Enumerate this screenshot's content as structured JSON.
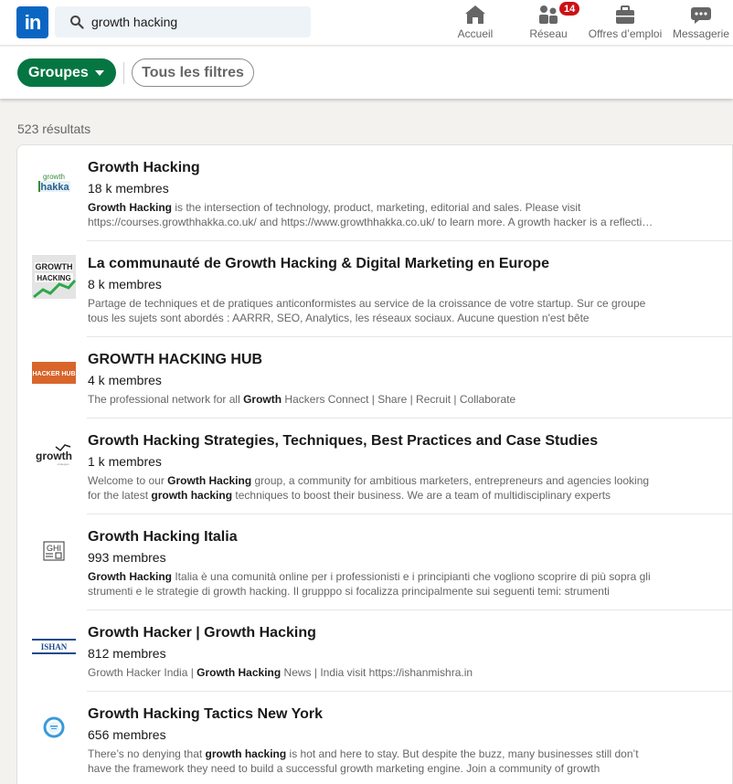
{
  "nav": {
    "logo_text": "in",
    "search_value": "growth hacking",
    "items": [
      {
        "label": "Accueil",
        "icon": "home-icon"
      },
      {
        "label": "Réseau",
        "icon": "network-icon",
        "badge": "14"
      },
      {
        "label": "Offres d’emploi",
        "icon": "briefcase-icon"
      },
      {
        "label": "Messagerie",
        "icon": "messaging-icon"
      }
    ]
  },
  "filters": {
    "active": "Groupes",
    "all": "Tous les filtres"
  },
  "results_count": "523 résultats",
  "colors": {
    "linkedin_blue": "#0a66c2",
    "active_filter_green": "#057642",
    "badge_red": "#cc1016"
  },
  "results": [
    {
      "title": "Growth Hacking",
      "members": "18 k membres",
      "desc_parts": [
        {
          "t": "Growth Hacking",
          "b": true
        },
        {
          "t": " is the intersection of technology, product, marketing, editorial and sales. Please visit https://courses.growthhakka.co.uk/ and https://www.growthhakka.co.uk/ to learn more. A growth hacker is a reflection of what is possible in",
          "b": false
        }
      ],
      "thumb_text": "growth hakka"
    },
    {
      "title": "La communauté de Growth Hacking & Digital Marketing en Europe",
      "members": "8 k membres",
      "desc_parts": [
        {
          "t": "Partage de techniques et de pratiques anticonformistes au service de la croissance de votre startup. Sur ce groupe tous les sujets sont abordés : AARRR, SEO, Analytics, les réseaux sociaux. Aucune question n'est bête",
          "b": false
        }
      ],
      "thumb_text": "GROWTH HACKING"
    },
    {
      "title": "GROWTH HACKING HUB",
      "members": "4 k membres",
      "desc_parts": [
        {
          "t": "The professional network for all ",
          "b": false
        },
        {
          "t": "Growth",
          "b": true
        },
        {
          "t": " Hackers Connect | Share | Recruit | Collaborate",
          "b": false
        }
      ],
      "thumb_text": "HACKER HUB"
    },
    {
      "title": "Growth Hacking Strategies, Techniques, Best Practices and Case Studies",
      "members": "1 k membres",
      "desc_parts": [
        {
          "t": "Welcome to our ",
          "b": false
        },
        {
          "t": "Growth Hacking",
          "b": true
        },
        {
          "t": " group, a community for ambitious marketers, entrepreneurs and agencies looking for the latest ",
          "b": false
        },
        {
          "t": "growth hacking",
          "b": true
        },
        {
          "t": " techniques to boost their business. We are a team of multidisciplinary experts",
          "b": false
        }
      ],
      "thumb_text": "growth"
    },
    {
      "title": "Growth Hacking Italia",
      "members": "993 membres",
      "desc_parts": [
        {
          "t": "Growth Hacking",
          "b": true
        },
        {
          "t": " Italia è una comunità online per i professionisti e i principianti che vogliono scoprire di più sopra gli strumenti e le strategie di growth hacking. Il grupppo si focalizza principalmente sui seguenti temi: strumenti",
          "b": false
        }
      ],
      "thumb_text": "GHI"
    },
    {
      "title": "Growth Hacker | Growth Hacking",
      "members": "812 membres",
      "desc_parts": [
        {
          "t": "Growth Hacker India | ",
          "b": false
        },
        {
          "t": "Growth Hacking",
          "b": true
        },
        {
          "t": " News | India visit https://ishanmishra.in",
          "b": false
        }
      ],
      "thumb_text": "ISHAN"
    },
    {
      "title": "Growth Hacking Tactics New York",
      "members": "656 membres",
      "desc_parts": [
        {
          "t": "There’s no denying that ",
          "b": false
        },
        {
          "t": "growth hacking",
          "b": true
        },
        {
          "t": " is hot and here to stay. But despite the buzz, many businesses still don’t have the framework they need to build a successful growth marketing engine. Join a community of growth",
          "b": false
        }
      ],
      "thumb_text": ""
    }
  ]
}
